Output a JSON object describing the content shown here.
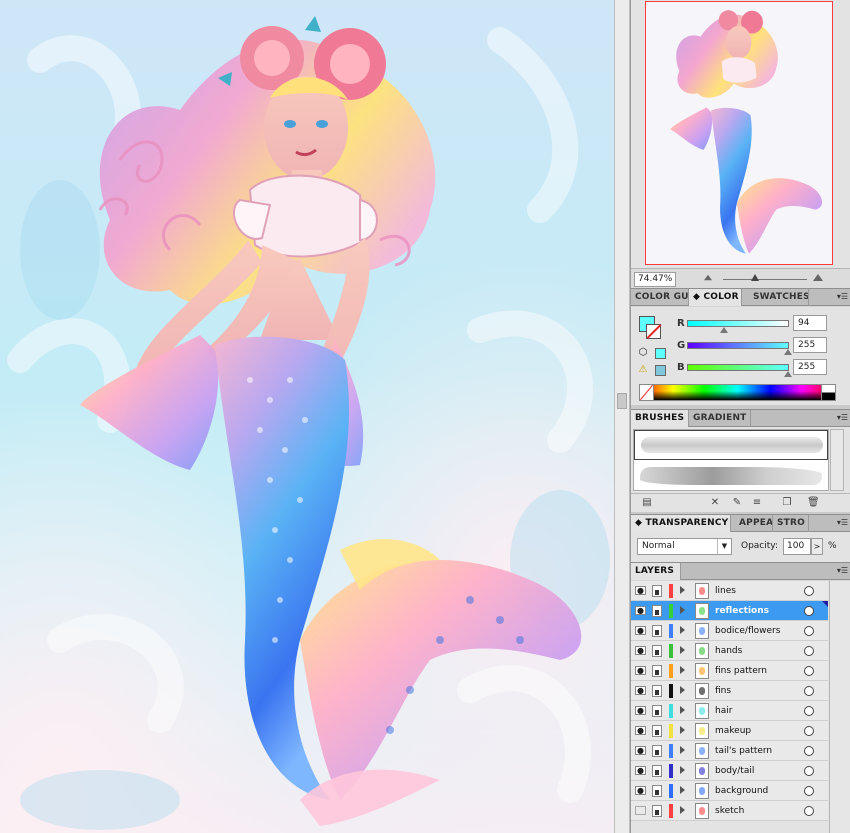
{
  "navigator": {
    "zoom": "74.47%"
  },
  "color_panel": {
    "tabs": [
      "COLOR GU",
      "COLOR",
      "SWATCHES"
    ],
    "active_tab": "COLOR",
    "fill_color": "#5effff",
    "r_label": "R",
    "g_label": "G",
    "b_label": "B",
    "r_value": "94",
    "g_value": "255",
    "b_value": "255"
  },
  "brushes_panel": {
    "tabs": [
      "BRUSHES",
      "GRADIENT"
    ]
  },
  "transparency_panel": {
    "tabs": [
      "TRANSPARENCY",
      "APPEA",
      "STRO"
    ],
    "blend_mode": "Normal",
    "opacity_label": "Opacity:",
    "opacity_value": "100",
    "opacity_unit": "%"
  },
  "layers_panel": {
    "title": "LAYERS",
    "layers": [
      {
        "name": "lines",
        "color": "#ff4040",
        "visible": true
      },
      {
        "name": "reflections",
        "color": "#38d038",
        "visible": true,
        "selected": true
      },
      {
        "name": "bodice/flowers",
        "color": "#3f7fff",
        "visible": true
      },
      {
        "name": "hands",
        "color": "#39c239",
        "visible": true
      },
      {
        "name": "fins pattern",
        "color": "#ff9f1a",
        "visible": true
      },
      {
        "name": "fins",
        "color": "#111111",
        "visible": true
      },
      {
        "name": "hair",
        "color": "#3fdede",
        "visible": true
      },
      {
        "name": "makeup",
        "color": "#f0e040",
        "visible": true
      },
      {
        "name": "tail's pattern",
        "color": "#3f7fff",
        "visible": true
      },
      {
        "name": "body/tail",
        "color": "#3030c8",
        "visible": true
      },
      {
        "name": "background",
        "color": "#2f6fff",
        "visible": true
      },
      {
        "name": "sketch",
        "color": "#ff4040",
        "visible": false
      }
    ]
  }
}
